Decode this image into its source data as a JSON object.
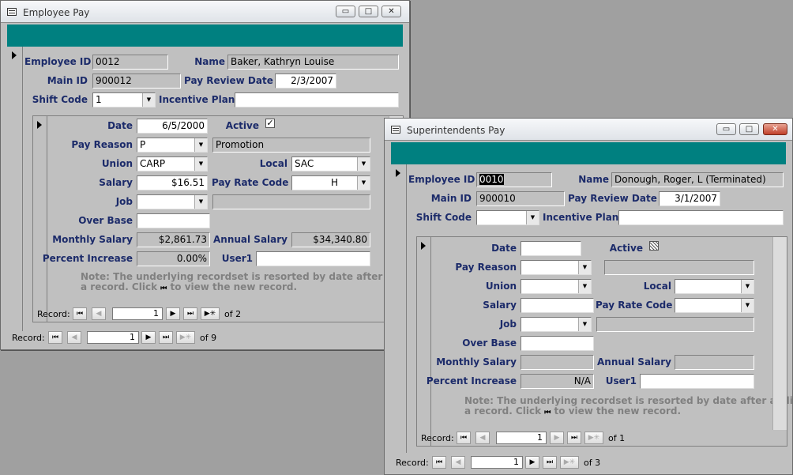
{
  "emp": {
    "title": "Employee Pay",
    "labels": {
      "employee_id": "Employee ID",
      "name": "Name",
      "main_id": "Main ID",
      "pay_review_date": "Pay Review Date",
      "shift_code": "Shift Code",
      "incentive_plan": "Incentive Plan"
    },
    "values": {
      "employee_id": "0012",
      "name": "Baker, Kathryn Louise",
      "main_id": "900012",
      "pay_review_date": "2/3/2007",
      "shift_code": "1",
      "incentive_plan": ""
    },
    "sub": {
      "labels": {
        "date": "Date",
        "active": "Active",
        "pay_reason": "Pay Reason",
        "union": "Union",
        "local": "Local",
        "salary": "Salary",
        "pay_rate_code": "Pay Rate Code",
        "job": "Job",
        "over_base": "Over Base",
        "monthly_salary": "Monthly Salary",
        "annual_salary": "Annual Salary",
        "percent_increase": "Percent Increase",
        "user1": "User1"
      },
      "values": {
        "date": "6/5/2000",
        "active_mark": "✓",
        "pay_reason": "P",
        "pay_reason_desc": "Promotion",
        "union": "CARP",
        "local": "SAC",
        "salary": "$16.51",
        "pay_rate_code": "H",
        "job": "",
        "job_desc": "",
        "over_base": "",
        "monthly_salary": "$2,861.73",
        "annual_salary": "$34,340.80",
        "percent_increase": "0.00%",
        "user1": ""
      },
      "note1": "Note:  The underlying recordset is resorted by date after adding",
      "note2a": "a record.  Click",
      "note2b": "to view the new record.",
      "nav": {
        "label": "Record:",
        "current": "1",
        "of": "of  2"
      }
    },
    "nav": {
      "label": "Record:",
      "current": "1",
      "of": "of  9"
    }
  },
  "sup": {
    "title": "Superintendents Pay",
    "labels": {
      "employee_id": "Employee ID",
      "name": "Name",
      "main_id": "Main ID",
      "pay_review_date": "Pay Review Date",
      "shift_code": "Shift Code",
      "incentive_plan": "Incentive Plan"
    },
    "values": {
      "employee_id": "0010",
      "name": "Donough, Roger, L (Terminated)",
      "main_id": "900010",
      "pay_review_date": "3/1/2007",
      "shift_code": "",
      "incentive_plan": ""
    },
    "sub": {
      "labels": {
        "date": "Date",
        "active": "Active",
        "pay_reason": "Pay Reason",
        "union": "Union",
        "local": "Local",
        "salary": "Salary",
        "pay_rate_code": "Pay Rate Code",
        "job": "Job",
        "over_base": "Over Base",
        "monthly_salary": "Monthly Salary",
        "annual_salary": "Annual Salary",
        "percent_increase": "Percent Increase",
        "user1": "User1"
      },
      "values": {
        "date": "",
        "pay_reason": "",
        "pay_reason_desc": "",
        "union": "",
        "local": "",
        "salary": "",
        "pay_rate_code": "",
        "job": "",
        "job_desc": "",
        "over_base": "",
        "monthly_salary": "",
        "annual_salary": "",
        "percent_increase": "N/A",
        "user1": ""
      },
      "note1": "Note:  The underlying recordset is resorted by date after adding",
      "note2a": "a record.  Click",
      "note2b": "to view the new record.",
      "nav": {
        "label": "Record:",
        "current": "1",
        "of": "of  1"
      }
    },
    "nav": {
      "label": "Record:",
      "current": "1",
      "of": "of  3"
    }
  },
  "icons": {
    "first": "⏮",
    "prev": "◀",
    "next": "▶",
    "last": "⏭",
    "new": "▶✳",
    "dropdown": "▼",
    "minimize": "▭",
    "maximize": "□",
    "close": "✕"
  },
  "colors": {
    "header_band": "#008080",
    "label_text": "#1c2b6a",
    "note_text": "#808080",
    "close_button": "#c0402a"
  }
}
